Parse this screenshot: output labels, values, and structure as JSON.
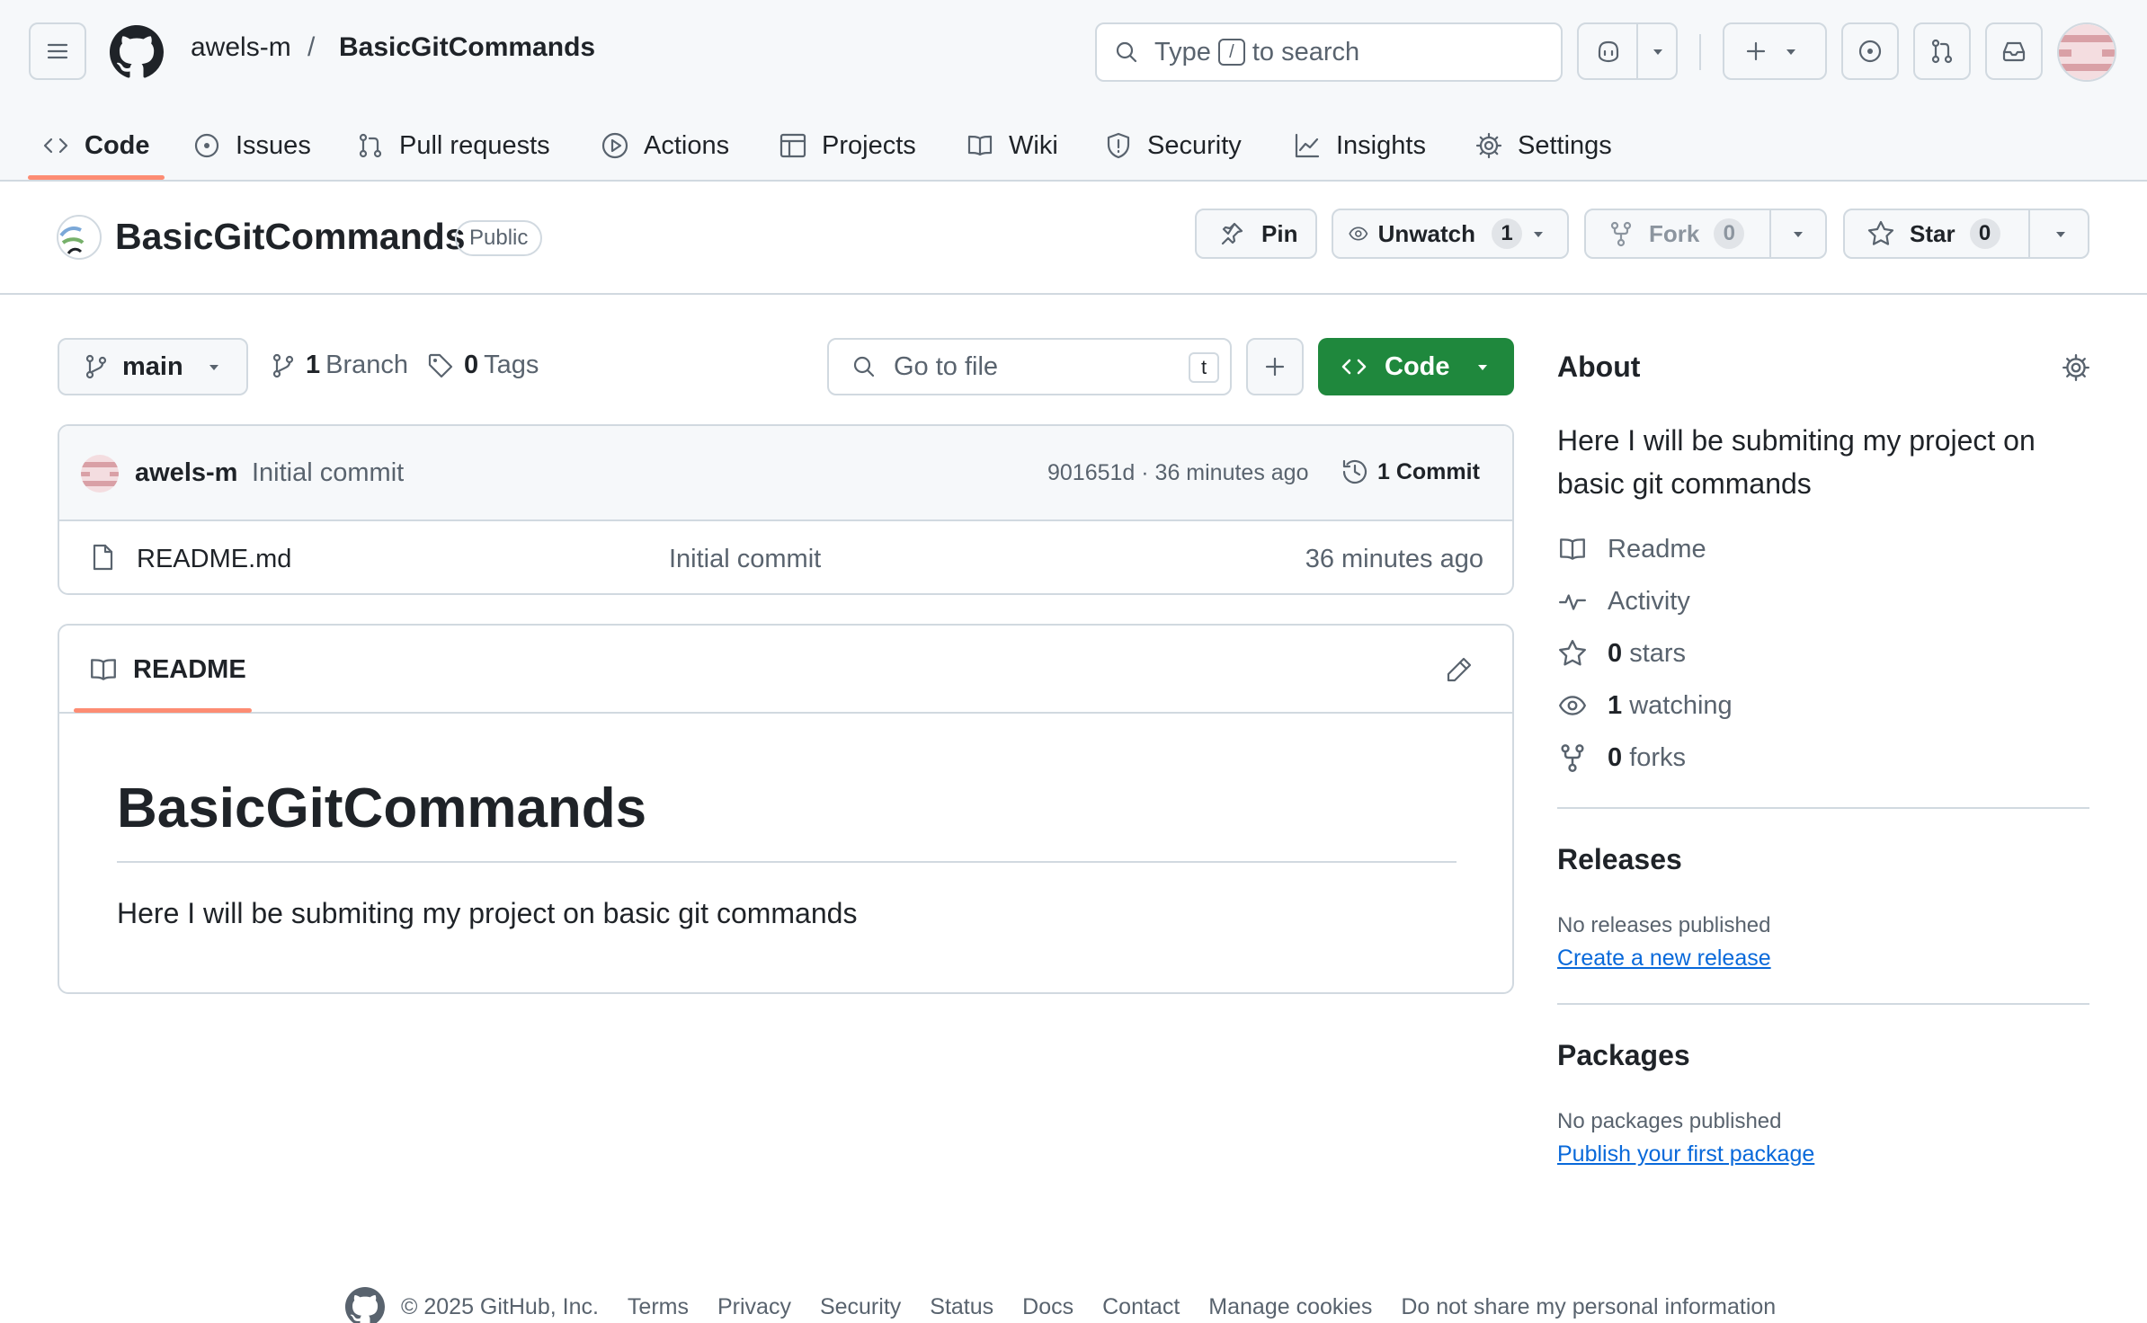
{
  "header": {
    "owner": "awels-m",
    "separator": "/",
    "repo": "BasicGitCommands",
    "search": {
      "prefix": "Type",
      "key": "/",
      "suffix": "to search"
    }
  },
  "nav_tabs": [
    {
      "label": "Code",
      "icon": "code-icon",
      "active": true
    },
    {
      "label": "Issues",
      "icon": "issue-icon"
    },
    {
      "label": "Pull requests",
      "icon": "pull-request-icon"
    },
    {
      "label": "Actions",
      "icon": "play-icon"
    },
    {
      "label": "Projects",
      "icon": "table-icon"
    },
    {
      "label": "Wiki",
      "icon": "book-icon"
    },
    {
      "label": "Security",
      "icon": "shield-icon"
    },
    {
      "label": "Insights",
      "icon": "graph-icon"
    },
    {
      "label": "Settings",
      "icon": "gear-icon"
    }
  ],
  "repo_bar": {
    "name": "BasicGitCommands",
    "visibility": "Public",
    "pin_label": "Pin",
    "watch_label": "Unwatch",
    "watch_count": "1",
    "fork_label": "Fork",
    "fork_count": "0",
    "star_label": "Star",
    "star_count": "0"
  },
  "toolbar": {
    "branch": "main",
    "branch_count": "1",
    "branch_label": "Branch",
    "tag_count": "0",
    "tag_label": "Tags",
    "goto_placeholder": "Go to file",
    "goto_key": "t",
    "code_label": "Code"
  },
  "latest_commit": {
    "author": "awels-m",
    "message": "Initial commit",
    "sha_time": "901651d · 36 minutes ago",
    "commit_count": "1 Commit"
  },
  "files": [
    {
      "name": "README.md",
      "message": "Initial commit",
      "time": "36 minutes ago"
    }
  ],
  "readme": {
    "tab": "README",
    "heading": "BasicGitCommands",
    "body": "Here I will be submiting my project on basic git commands"
  },
  "about": {
    "title": "About",
    "description": "Here I will be submiting my project on basic git commands",
    "readme": "Readme",
    "activity": "Activity",
    "stars_count": "0",
    "stars_label": "stars",
    "watching_count": "1",
    "watching_label": "watching",
    "forks_count": "0",
    "forks_label": "forks"
  },
  "releases": {
    "title": "Releases",
    "empty": "No releases published",
    "link": "Create a new release"
  },
  "packages": {
    "title": "Packages",
    "empty": "No packages published",
    "link": "Publish your first package"
  },
  "footer": {
    "copyright": "© 2025 GitHub, Inc.",
    "links": [
      "Terms",
      "Privacy",
      "Security",
      "Status",
      "Docs",
      "Contact",
      "Manage cookies",
      "Do not share my personal information"
    ]
  },
  "colors": {
    "accent_underline": "#fd8c73",
    "code_button": "#1f883d",
    "link": "#0969da",
    "border": "#d1d9e0"
  }
}
